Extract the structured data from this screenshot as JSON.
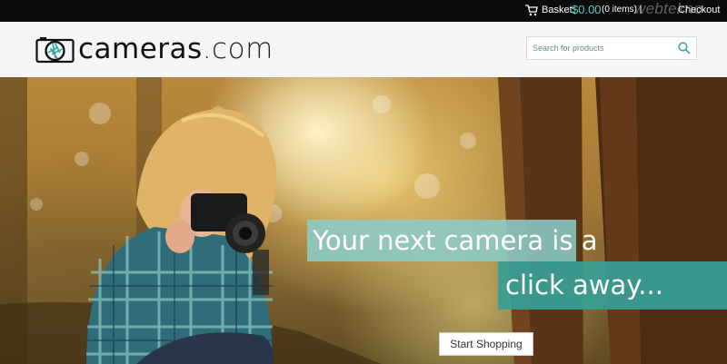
{
  "topbar": {
    "basket_label": "Basket:",
    "basket_total": "$0.00",
    "basket_count": "(0 items) |",
    "checkout_label": "Checkout",
    "watermark": "webtekno",
    "cart_icon": "cart-icon",
    "total_color": "#4fd1c5"
  },
  "header": {
    "logo_name": "cameras",
    "logo_tld": ".com",
    "logo_icon": "camera-icon",
    "search_placeholder": "Search for products",
    "search_value": "",
    "search_icon": "search-icon"
  },
  "hero": {
    "headline_line1": "Your next camera is a",
    "headline_line2": "click away...",
    "cta_label": "Start Shopping",
    "accent_light": "#8ccdcb",
    "accent_dark": "#37a096"
  }
}
